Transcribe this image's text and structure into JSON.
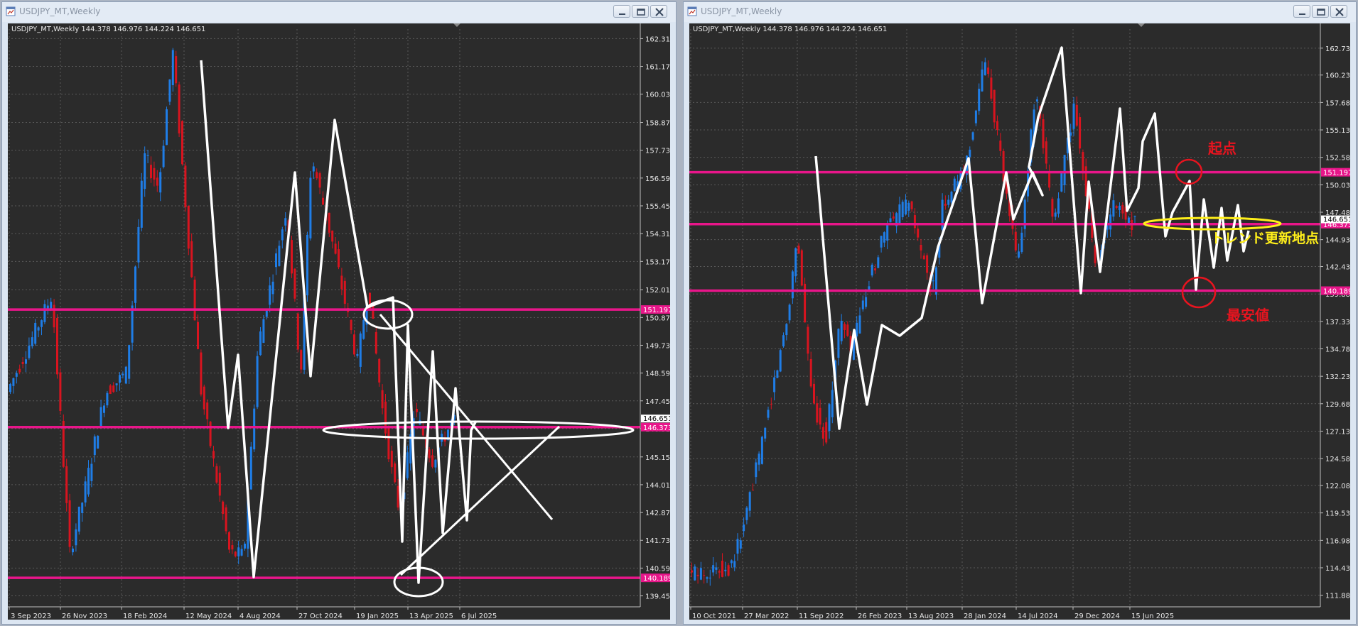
{
  "colors": {
    "bull": "#1f7de6",
    "bear": "#d8141f",
    "hline": "#e8168a",
    "grid": "#5a5a5a",
    "axis_text": "#e6e6e6",
    "chart_bg": "#2b2b2b",
    "annot_red": "#e8141f",
    "annot_yellow": "#ffef1a"
  },
  "icons": [
    "chart-window-icon",
    "minimize-icon",
    "restore-icon",
    "close-icon"
  ],
  "left": {
    "window_title": "USDJPY_MT,Weekly",
    "symbol_info": "USDJPY_MT,Weekly  144.378 146.976 144.224 146.651",
    "price_labels": [
      "162.310",
      "161.170",
      "160.030",
      "158.870",
      "157.730",
      "156.590",
      "155.450",
      "154.310",
      "153.170",
      "152.010",
      "150.870",
      "149.730",
      "148.590",
      "147.450",
      "146.310",
      "145.150",
      "144.010",
      "142.870",
      "141.730",
      "140.590",
      "139.450"
    ],
    "price_range": [
      139.0,
      162.7
    ],
    "date_labels": [
      "3 Sep 2023",
      "26 Nov 2023",
      "18 Feb 2024",
      "12 May 2024",
      "4 Aug 2024",
      "27 Oct 2024",
      "19 Jan 2025",
      "13 Apr 2025",
      "6 Jul 2025"
    ],
    "current_price_label": "146.651",
    "hline_labels": [
      {
        "price": 151.197,
        "text": "151.197"
      },
      {
        "price": 146.373,
        "text": "146.373"
      },
      {
        "price": 140.189,
        "text": "140.189"
      }
    ]
  },
  "right": {
    "window_title": "USDJPY_MT,Weekly",
    "symbol_info": "USDJPY_MT,Weekly  144.378 146.976 144.224 146.651",
    "price_labels": [
      "162.730",
      "160.230",
      "157.680",
      "155.130",
      "152.580",
      "150.030",
      "147.480",
      "144.930",
      "142.430",
      "139.880",
      "137.330",
      "134.780",
      "132.230",
      "129.680",
      "127.130",
      "124.580",
      "122.080",
      "119.530",
      "116.980",
      "114.430",
      "111.880"
    ],
    "price_range": [
      110.8,
      164.5
    ],
    "date_labels": [
      "10 Oct 2021",
      "27 Mar 2022",
      "11 Sep 2022",
      "26 Feb 2023",
      "13 Aug 2023",
      "28 Jan 2024",
      "14 Jul 2024",
      "29 Dec 2024",
      "15 Jun 2025"
    ],
    "current_price_label": "146.651",
    "hline_labels": [
      {
        "price": 151.197,
        "text": "151.197"
      },
      {
        "price": 146.373,
        "text": "146.373"
      },
      {
        "price": 140.189,
        "text": "140.189"
      }
    ],
    "annotations": {
      "start_point": "起点",
      "trend_update_point": "トレンド更新地点",
      "lowest_price": "最安値"
    }
  }
}
